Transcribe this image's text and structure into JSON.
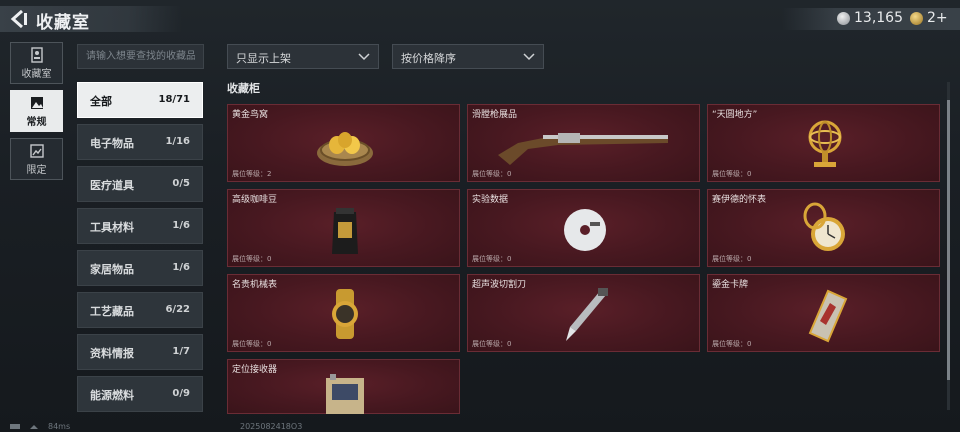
{
  "header": {
    "title": "收藏室",
    "currency": [
      {
        "value": "13,165",
        "icon": "silver-coin-icon"
      },
      {
        "value": "2+",
        "icon": "gold-coin-icon"
      }
    ]
  },
  "nav": [
    {
      "label": "收藏室",
      "icon": "collection-room-icon",
      "active": false
    },
    {
      "label": "常规",
      "icon": "regular-image-icon",
      "active": true
    },
    {
      "label": "限定",
      "icon": "limited-image-icon",
      "active": false
    }
  ],
  "search": {
    "placeholder": "请输入想要查找的收藏品"
  },
  "filters": {
    "display": "只显示上架",
    "sort": "按价格降序"
  },
  "categories": [
    {
      "name": "全部",
      "count": "18/71",
      "active": true
    },
    {
      "name": "电子物品",
      "count": "1/16"
    },
    {
      "name": "医疗道具",
      "count": "0/5"
    },
    {
      "name": "工具材料",
      "count": "1/6"
    },
    {
      "name": "家居物品",
      "count": "1/6"
    },
    {
      "name": "工艺藏品",
      "count": "6/22"
    },
    {
      "name": "资料情报",
      "count": "1/7"
    },
    {
      "name": "能源燃料",
      "count": "0/9"
    }
  ],
  "cabinet": {
    "title": "收藏柜",
    "items": [
      {
        "name": "黄金鸟窝",
        "level": "展位等级：2",
        "icon": "golden-nest-icon"
      },
      {
        "name": "滑膛枪展品",
        "level": "展位等级：0",
        "icon": "musket-icon"
      },
      {
        "name": "“天圆地方”",
        "level": "展位等级：0",
        "icon": "armillary-sphere-icon"
      },
      {
        "name": "高级咖啡豆",
        "level": "展位等级：0",
        "icon": "coffee-bag-icon"
      },
      {
        "name": "实验数据",
        "level": "展位等级：0",
        "icon": "data-disc-icon"
      },
      {
        "name": "赛伊德的怀表",
        "level": "展位等级：0",
        "icon": "pocket-watch-icon"
      },
      {
        "name": "名贵机械表",
        "level": "展位等级：0",
        "icon": "wristwatch-icon"
      },
      {
        "name": "超声波切割刀",
        "level": "展位等级：0",
        "icon": "ultrasonic-cutter-icon"
      },
      {
        "name": "鎏金卡牌",
        "level": "展位等级：0",
        "icon": "gilded-card-icon"
      },
      {
        "name": "定位接收器",
        "level": "",
        "icon": "locator-receiver-icon"
      }
    ]
  },
  "status": {
    "ping": "84ms",
    "build": "2025082418O3"
  }
}
